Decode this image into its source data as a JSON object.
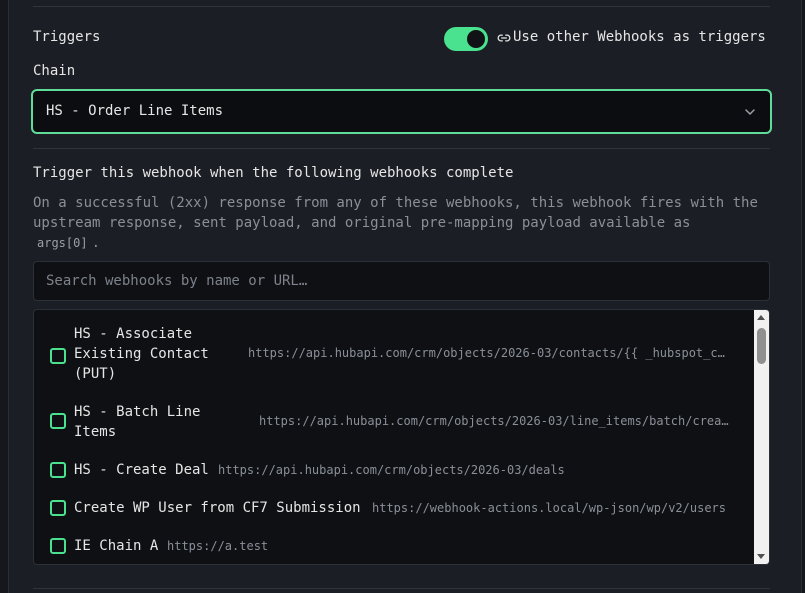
{
  "triggers": {
    "label": "Triggers",
    "toggle_on": true,
    "use_other_label": "Use other Webhooks as triggers"
  },
  "chain": {
    "label": "Chain",
    "selected": "HS - Order Line Items"
  },
  "section": {
    "title": "Trigger this webhook when the following webhooks complete",
    "help_text": "On a successful (2xx) response from any of these webhooks, this webhook fires with the upstream response, sent payload, and original pre-mapping payload available as",
    "help_code": "args[0]",
    "help_suffix": "."
  },
  "search": {
    "placeholder": "Search webhooks by name or URL…"
  },
  "webhooks": [
    {
      "name": "HS - Associate Existing Contact (PUT)",
      "url": "https://api.hubapi.com/crm/objects/2026-03/contacts/{{ _hubspot_c…",
      "checked": false
    },
    {
      "name": "HS - Batch Line Items",
      "url": "https://api.hubapi.com/crm/objects/2026-03/line_items/batch/crea…",
      "checked": false
    },
    {
      "name": "HS - Create Deal",
      "url": "https://api.hubapi.com/crm/objects/2026-03/deals",
      "checked": false
    },
    {
      "name": "Create WP User from CF7 Submission",
      "url": "https://webhook-actions.local/wp-json/wp/v2/users",
      "checked": false
    },
    {
      "name": "IE Chain A",
      "url": "https://a.test",
      "checked": false
    }
  ],
  "colors": {
    "accent": "#4ae18f",
    "focus_border": "#5fdc9a",
    "background": "#1b1e25"
  }
}
